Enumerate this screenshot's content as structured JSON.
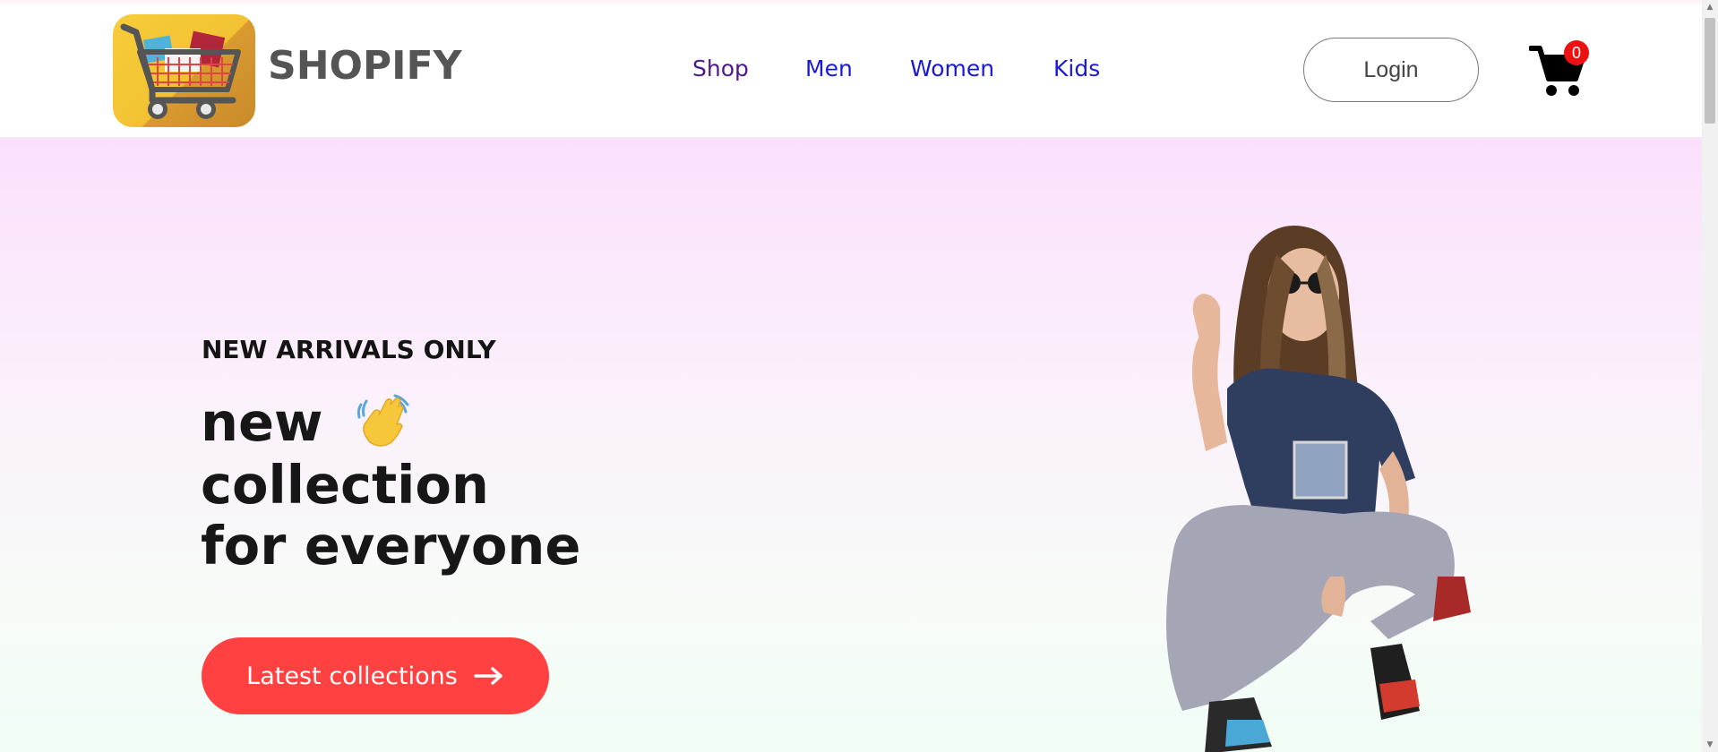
{
  "brand": {
    "name": "SHOPIFY",
    "logo_icon": "shopping-cart-logo"
  },
  "nav": {
    "items": [
      {
        "label": "Shop",
        "visited": true
      },
      {
        "label": "Men",
        "visited": false
      },
      {
        "label": "Women",
        "visited": false
      },
      {
        "label": "Kids",
        "visited": false
      }
    ]
  },
  "header": {
    "login_label": "Login",
    "cart_icon": "cart-icon",
    "cart_count": "0"
  },
  "hero": {
    "eyebrow": "NEW ARRIVALS ONLY",
    "headline_1": "new",
    "headline_emoji": "waving-hand-icon",
    "headline_2": "collection",
    "headline_3": "for everyone",
    "cta_label": "Latest collections",
    "cta_icon": "arrow-right-icon",
    "image": "hero-model-image"
  },
  "colors": {
    "accent": "#ff4141",
    "nav_link": "#1a1ad6",
    "nav_visited": "#4b1a8c",
    "badge": "#ee1111"
  }
}
